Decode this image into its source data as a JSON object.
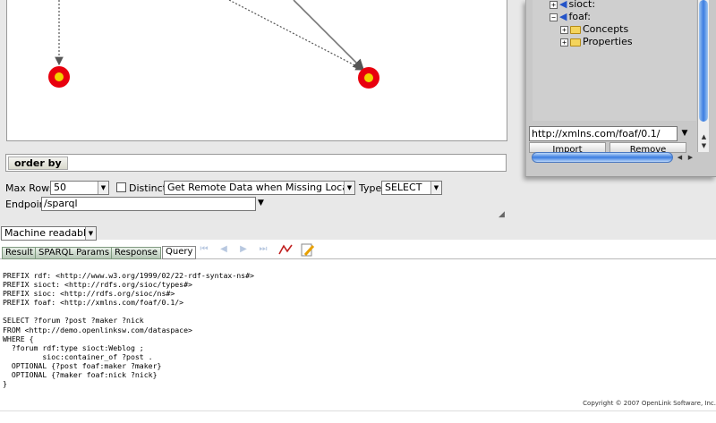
{
  "namespace_panel": {
    "tree": [
      {
        "label": "sioct:",
        "expander": "+",
        "type": "namespace"
      },
      {
        "label": "foaf:",
        "expander": "−",
        "type": "namespace"
      },
      {
        "label": "Concepts",
        "expander": "+",
        "type": "folder"
      },
      {
        "label": "Properties",
        "expander": "+",
        "type": "folder"
      }
    ],
    "url_value": "http://xmlns.com/foaf/0.1/",
    "import_label": "Import",
    "remove_label": "Remove"
  },
  "order_by": {
    "label": "order by",
    "value": ""
  },
  "controls": {
    "max_rows_label": "Max Rows",
    "max_rows_value": "50",
    "distinct_label": "Distinct",
    "distinct_checked": false,
    "remote_data_value": "Get Remote Data when Missing Locally",
    "type_label": "Type",
    "type_value": "SELECT",
    "endpoint_label": "Endpoint",
    "endpoint_value": "/sparql"
  },
  "output_format": {
    "value": "Machine readable"
  },
  "tabs": [
    {
      "label": "Result",
      "active": false
    },
    {
      "label": "SPARQL Params",
      "active": false
    },
    {
      "label": "Response",
      "active": false
    },
    {
      "label": "Query",
      "active": true
    }
  ],
  "toolbar_icons": [
    "first-icon",
    "prev-icon",
    "next-icon",
    "last-icon",
    "graph-view-icon",
    "edit-icon"
  ],
  "query_text": "PREFIX rdf: <http://www.w3.org/1999/02/22-rdf-syntax-ns#>\nPREFIX sioct: <http://rdfs.org/sioc/types#>\nPREFIX sioc: <http://rdfs.org/sioc/ns#>\nPREFIX foaf: <http://xmlns.com/foaf/0.1/>\n\nSELECT ?forum ?post ?maker ?nick\nFROM <http://demo.openlinksw.com/dataspace>\nWHERE {\n  ?forum rdf:type sioct:Weblog ;\n         sioc:container_of ?post .\n  OPTIONAL {?post foaf:maker ?maker}\n  OPTIONAL {?maker foaf:nick ?nick}\n}",
  "footer": {
    "copyright": "Copyright © 2007 OpenLink Software, Inc."
  },
  "colors": {
    "node_outer": "#e8000e",
    "node_inner": "#f2d200",
    "scroll_accent": "#3b7de0"
  }
}
